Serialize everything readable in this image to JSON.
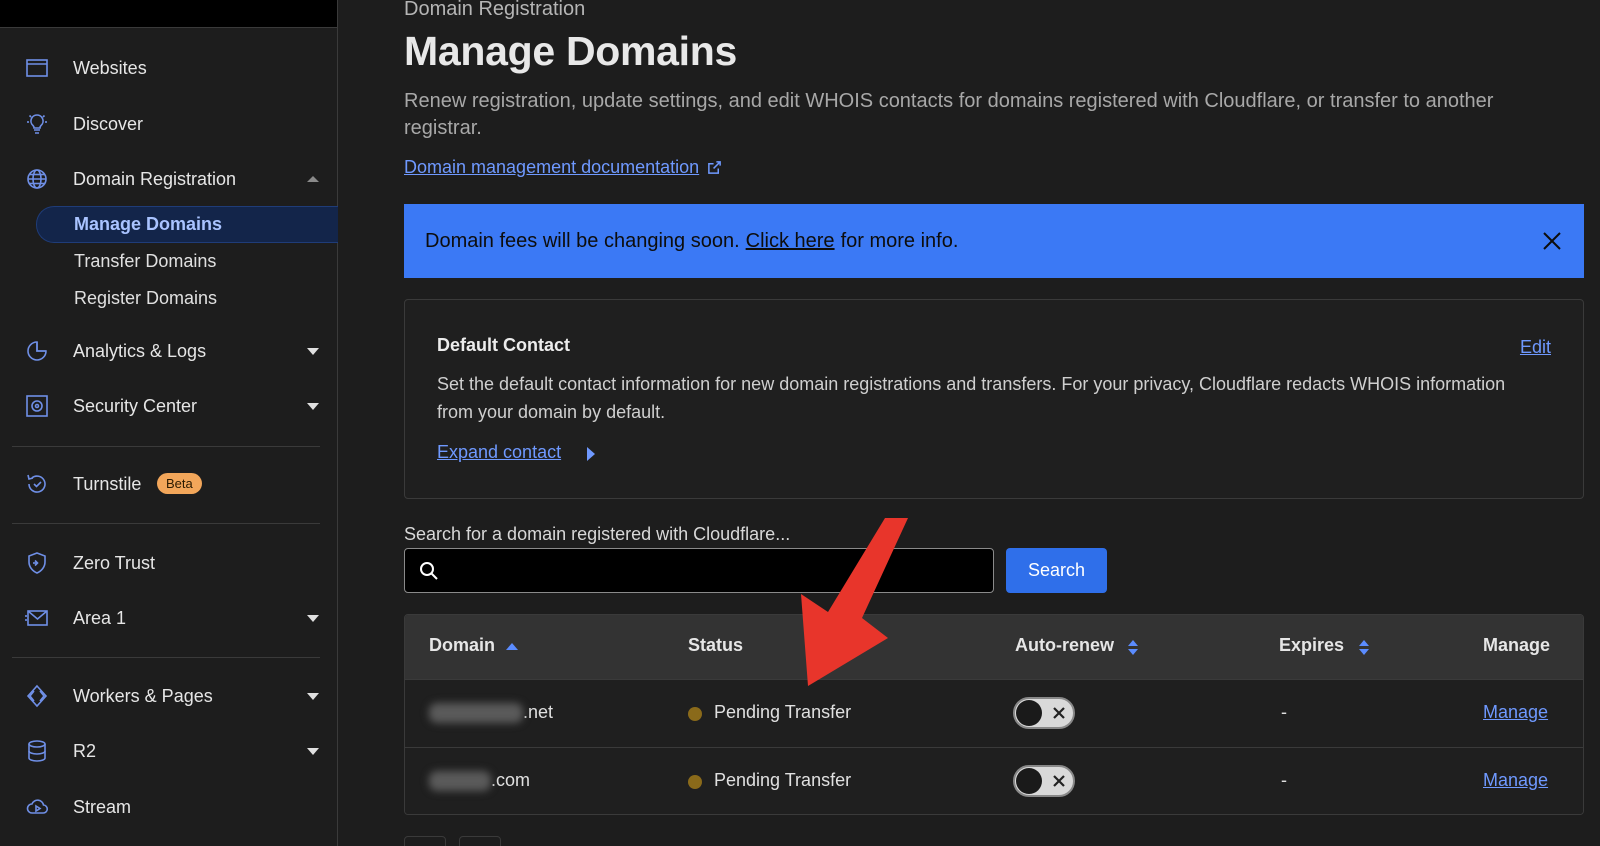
{
  "sidebar": {
    "items": [
      {
        "label": "Websites",
        "icon": "browser-window-icon"
      },
      {
        "label": "Discover",
        "icon": "lightbulb-icon"
      },
      {
        "label": "Domain Registration",
        "icon": "globe-icon"
      },
      {
        "label": "Analytics & Logs",
        "icon": "pie-chart-icon"
      },
      {
        "label": "Security Center",
        "icon": "security-icon"
      },
      {
        "label": "Turnstile",
        "icon": "turnstile-icon",
        "badge": "Beta"
      },
      {
        "label": "Zero Trust",
        "icon": "zero-trust-icon"
      },
      {
        "label": "Area 1",
        "icon": "envelope-icon"
      },
      {
        "label": "Workers & Pages",
        "icon": "workers-icon"
      },
      {
        "label": "R2",
        "icon": "database-icon"
      },
      {
        "label": "Stream",
        "icon": "cloud-play-icon"
      }
    ],
    "subitems": {
      "active": "Manage Domains",
      "transfer": "Transfer Domains",
      "register": "Register Domains"
    }
  },
  "main": {
    "breadcrumb": "Domain Registration",
    "title": "Manage Domains",
    "description": "Renew registration, update settings, and edit WHOIS contacts for domains registered with Cloudflare, or transfer to another registrar.",
    "doc_link": "Domain management documentation",
    "banner": {
      "before": "Domain fees will be changing soon.",
      "link": "Click here",
      "after": "for more info.",
      "color": "#3b79f5"
    },
    "default_contact": {
      "title": "Default Contact",
      "edit": "Edit",
      "text": "Set the default contact information for new domain registrations and transfers. For your privacy, Cloudflare redacts WHOIS information from your domain by default.",
      "expand": "Expand contact"
    },
    "search": {
      "label": "Search for a domain registered with Cloudflare...",
      "placeholder": "",
      "button": "Search"
    },
    "table": {
      "headers": {
        "domain": "Domain",
        "status": "Status",
        "auto_renew": "Auto-renew",
        "expires": "Expires",
        "manage": "Manage"
      },
      "rows": [
        {
          "domain_suffix": ".net",
          "status": "Pending Transfer",
          "auto_renew": false,
          "expires": "-",
          "manage": "Manage"
        },
        {
          "domain_suffix": ".com",
          "status": "Pending Transfer",
          "auto_renew": false,
          "expires": "-",
          "manage": "Manage"
        }
      ]
    }
  },
  "colors": {
    "accent": "#6f99ff",
    "annotation_arrow": "#e8352b",
    "status_pending": "#8a6a1a"
  }
}
